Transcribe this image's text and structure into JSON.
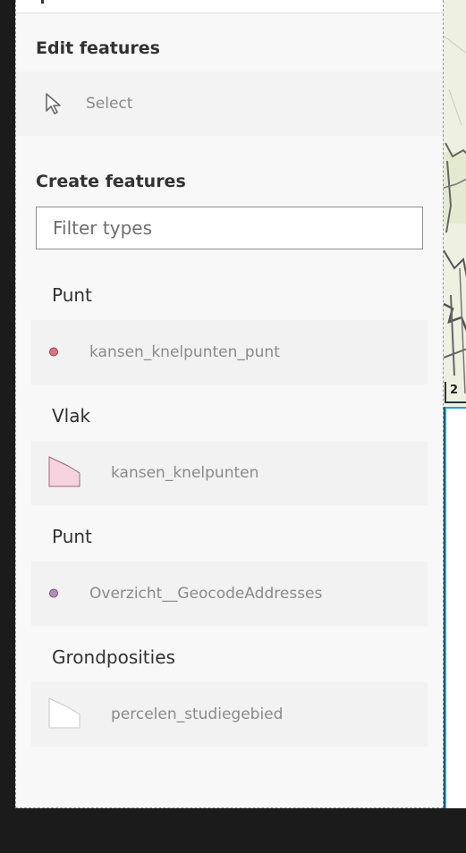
{
  "edit_features": {
    "title": "Edit features",
    "select_label": "Select"
  },
  "create_features": {
    "title": "Create features",
    "filter_placeholder": "Filter types"
  },
  "groups": [
    {
      "title": "Punt",
      "item": {
        "label": "kansen_knelpunten_punt",
        "symbol": "point",
        "color": "#e0707a"
      }
    },
    {
      "title": "Vlak",
      "item": {
        "label": "kansen_knelpunten",
        "symbol": "polygon",
        "color": "#f6d0dc"
      }
    },
    {
      "title": "Punt",
      "item": {
        "label": "Overzicht__GeocodeAddresses",
        "symbol": "point",
        "color": "#b48ab8"
      }
    },
    {
      "title": "Grondposities",
      "item": {
        "label": "percelen_studiegebied",
        "symbol": "polygon-outline",
        "color": "#ffffff"
      }
    }
  ],
  "map": {
    "scale_label": "2"
  },
  "colors": {
    "accent_border": "#27a2c4",
    "panel_background": "#f8f8f8"
  }
}
